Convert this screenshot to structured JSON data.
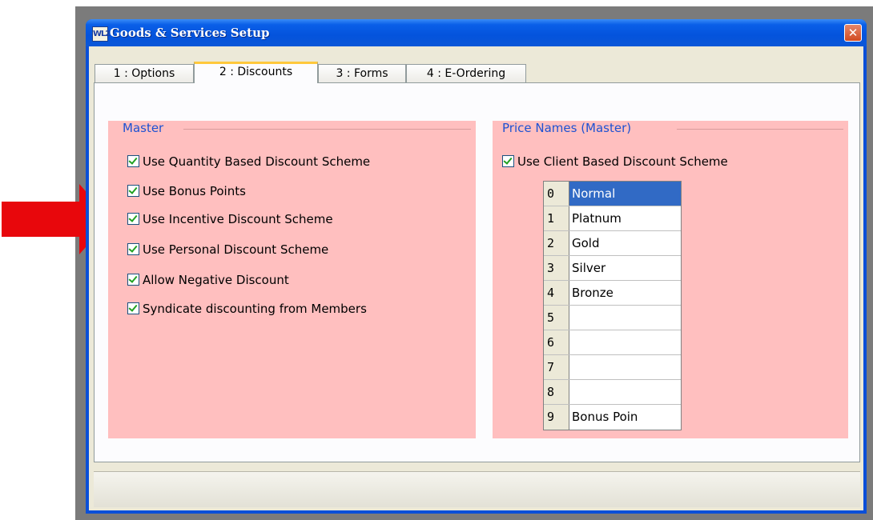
{
  "window": {
    "title": "Goods & Services Setup",
    "app_icon_text": "WL2",
    "close_label": "✕"
  },
  "tabs": [
    {
      "label": "1 : Options",
      "active": false
    },
    {
      "label": "2 : Discounts",
      "active": true
    },
    {
      "label": "3 : Forms",
      "active": false
    },
    {
      "label": "4 : E-Ordering",
      "active": false
    }
  ],
  "master": {
    "title": "Master",
    "options": [
      {
        "label": "Use Quantity Based Discount Scheme",
        "checked": true
      },
      {
        "label": "Use Bonus Points",
        "checked": true
      },
      {
        "label": "Use Incentive Discount Scheme",
        "checked": true
      },
      {
        "label": "Use Personal  Discount Scheme",
        "checked": true
      },
      {
        "label": "Allow Negative Discount",
        "checked": true
      },
      {
        "label": "Syndicate discounting from Members",
        "checked": true
      }
    ]
  },
  "price_names": {
    "title": "Price Names (Master)",
    "client_scheme_label": "Use Client Based Discount Scheme",
    "client_scheme_checked": true,
    "rows": [
      {
        "num": "0",
        "name": "Normal",
        "selected": true
      },
      {
        "num": "1",
        "name": "Platnum",
        "selected": false
      },
      {
        "num": "2",
        "name": "Gold",
        "selected": false
      },
      {
        "num": "3",
        "name": "Silver",
        "selected": false
      },
      {
        "num": "4",
        "name": "Bronze",
        "selected": false
      },
      {
        "num": "5",
        "name": "",
        "selected": false
      },
      {
        "num": "6",
        "name": "",
        "selected": false
      },
      {
        "num": "7",
        "name": "",
        "selected": false
      },
      {
        "num": "8",
        "name": "",
        "selected": false
      },
      {
        "num": "9",
        "name": "Bonus Poin",
        "selected": false
      }
    ]
  },
  "colors": {
    "group_bg": "#ffbfbf",
    "group_title": "#1e52d2",
    "selection": "#316ac5",
    "arrow": "#e8070c",
    "titlebar": "#0453dc"
  }
}
